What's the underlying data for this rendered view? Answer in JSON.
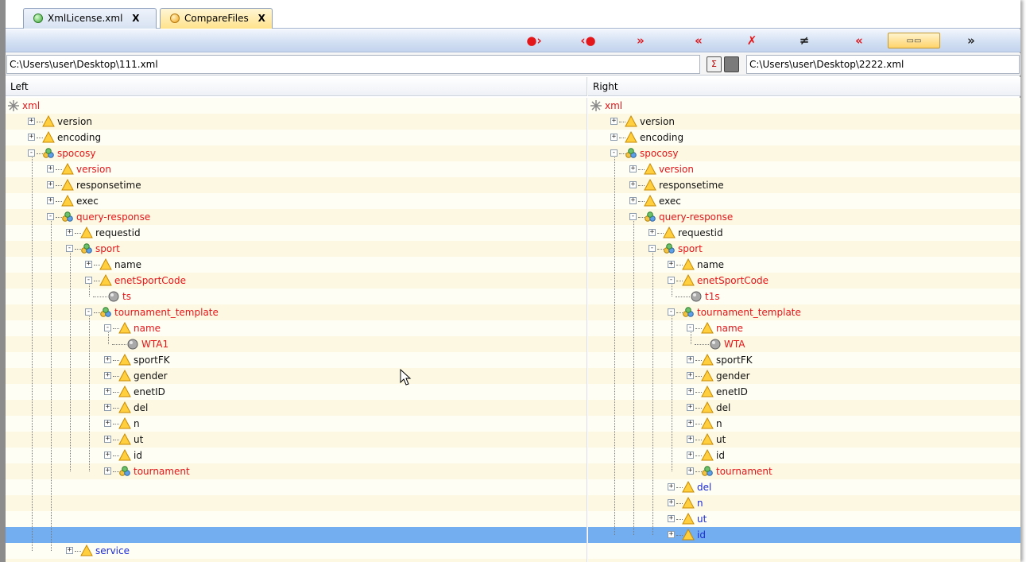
{
  "tabs": [
    {
      "label": "XmlLicense.xml",
      "close": "X",
      "active": false
    },
    {
      "label": "CompareFiles",
      "close": "X",
      "active": true
    }
  ],
  "toolbar": {
    "buttons": [
      {
        "name": "next-diff-icon",
        "glyph": "●›"
      },
      {
        "name": "prev-diff-icon",
        "glyph": "‹●"
      },
      {
        "name": "copy-right-icon",
        "glyph": "»"
      },
      {
        "name": "copy-left-icon",
        "glyph": "«"
      },
      {
        "name": "clear-icon",
        "glyph": "✗"
      },
      {
        "name": "not-equal-icon",
        "glyph": "≠"
      },
      {
        "name": "previous-icon",
        "glyph": "«"
      },
      {
        "name": "view-toggle-icon",
        "glyph": "▭▭"
      },
      {
        "name": "forward-icon",
        "glyph": "»"
      }
    ]
  },
  "paths": {
    "left": "C:\\Users\\user\\Desktop\\111.xml",
    "right": "C:\\Users\\user\\Desktop\\2222.xml"
  },
  "panels": {
    "left_title": "Left",
    "right_title": "Right"
  },
  "colors": {
    "diff": "#e3161a",
    "normal": "#111111",
    "added": "#1c2cd6",
    "selection": "#72aef0"
  },
  "left_tree": [
    {
      "label": "xml",
      "depth": 0,
      "kind": "root",
      "color": "red"
    },
    {
      "label": "version",
      "depth": 1,
      "kind": "attr",
      "color": "black",
      "expander": "+"
    },
    {
      "label": "encoding",
      "depth": 1,
      "kind": "attr",
      "color": "black",
      "expander": "+"
    },
    {
      "label": "spocosy",
      "depth": 1,
      "kind": "elem",
      "color": "red",
      "expander": "-"
    },
    {
      "label": "version",
      "depth": 2,
      "kind": "attr",
      "color": "red",
      "expander": "+"
    },
    {
      "label": "responsetime",
      "depth": 2,
      "kind": "attr",
      "color": "black",
      "expander": "+"
    },
    {
      "label": "exec",
      "depth": 2,
      "kind": "attr",
      "color": "black",
      "expander": "+"
    },
    {
      "label": "query-response",
      "depth": 2,
      "kind": "elem",
      "color": "red",
      "expander": "-"
    },
    {
      "label": "requestid",
      "depth": 3,
      "kind": "attr",
      "color": "black",
      "expander": "+"
    },
    {
      "label": "sport",
      "depth": 3,
      "kind": "elem",
      "color": "red",
      "expander": "-"
    },
    {
      "label": "name",
      "depth": 4,
      "kind": "attr",
      "color": "black",
      "expander": "+"
    },
    {
      "label": "enetSportCode",
      "depth": 4,
      "kind": "attr",
      "color": "red",
      "expander": "-"
    },
    {
      "label": "ts",
      "depth": 5,
      "kind": "value",
      "color": "red"
    },
    {
      "label": "tournament_template",
      "depth": 4,
      "kind": "elem",
      "color": "red",
      "expander": "-"
    },
    {
      "label": "name",
      "depth": 5,
      "kind": "attr",
      "color": "red",
      "expander": "-"
    },
    {
      "label": "WTA1",
      "depth": 6,
      "kind": "value",
      "color": "red"
    },
    {
      "label": "sportFK",
      "depth": 5,
      "kind": "attr",
      "color": "black",
      "expander": "+"
    },
    {
      "label": "gender",
      "depth": 5,
      "kind": "attr",
      "color": "black",
      "expander": "+"
    },
    {
      "label": "enetID",
      "depth": 5,
      "kind": "attr",
      "color": "black",
      "expander": "+"
    },
    {
      "label": "del",
      "depth": 5,
      "kind": "attr",
      "color": "black",
      "expander": "+"
    },
    {
      "label": "n",
      "depth": 5,
      "kind": "attr",
      "color": "black",
      "expander": "+"
    },
    {
      "label": "ut",
      "depth": 5,
      "kind": "attr",
      "color": "black",
      "expander": "+"
    },
    {
      "label": "id",
      "depth": 5,
      "kind": "attr",
      "color": "black",
      "expander": "+"
    },
    {
      "label": "tournament",
      "depth": 5,
      "kind": "elem",
      "color": "red",
      "expander": "+"
    },
    {
      "label": "",
      "depth": 0,
      "kind": "blank"
    },
    {
      "label": "",
      "depth": 0,
      "kind": "blank"
    },
    {
      "label": "",
      "depth": 0,
      "kind": "blank"
    },
    {
      "label": "",
      "depth": 0,
      "kind": "selected"
    },
    {
      "label": "service",
      "depth": 3,
      "kind": "attr",
      "color": "blue",
      "expander": "+"
    }
  ],
  "right_tree": [
    {
      "label": "xml",
      "depth": 0,
      "kind": "root",
      "color": "red"
    },
    {
      "label": "version",
      "depth": 1,
      "kind": "attr",
      "color": "black",
      "expander": "+"
    },
    {
      "label": "encoding",
      "depth": 1,
      "kind": "attr",
      "color": "black",
      "expander": "+"
    },
    {
      "label": "spocosy",
      "depth": 1,
      "kind": "elem",
      "color": "red",
      "expander": "-"
    },
    {
      "label": "version",
      "depth": 2,
      "kind": "attr",
      "color": "red",
      "expander": "+"
    },
    {
      "label": "responsetime",
      "depth": 2,
      "kind": "attr",
      "color": "black",
      "expander": "+"
    },
    {
      "label": "exec",
      "depth": 2,
      "kind": "attr",
      "color": "black",
      "expander": "+"
    },
    {
      "label": "query-response",
      "depth": 2,
      "kind": "elem",
      "color": "red",
      "expander": "-"
    },
    {
      "label": "requestid",
      "depth": 3,
      "kind": "attr",
      "color": "black",
      "expander": "+"
    },
    {
      "label": "sport",
      "depth": 3,
      "kind": "elem",
      "color": "red",
      "expander": "-"
    },
    {
      "label": "name",
      "depth": 4,
      "kind": "attr",
      "color": "black",
      "expander": "+"
    },
    {
      "label": "enetSportCode",
      "depth": 4,
      "kind": "attr",
      "color": "red",
      "expander": "-"
    },
    {
      "label": "t1s",
      "depth": 5,
      "kind": "value",
      "color": "red"
    },
    {
      "label": "tournament_template",
      "depth": 4,
      "kind": "elem",
      "color": "red",
      "expander": "-"
    },
    {
      "label": "name",
      "depth": 5,
      "kind": "attr",
      "color": "red",
      "expander": "-"
    },
    {
      "label": "WTA",
      "depth": 6,
      "kind": "value",
      "color": "red"
    },
    {
      "label": "sportFK",
      "depth": 5,
      "kind": "attr",
      "color": "black",
      "expander": "+"
    },
    {
      "label": "gender",
      "depth": 5,
      "kind": "attr",
      "color": "black",
      "expander": "+"
    },
    {
      "label": "enetID",
      "depth": 5,
      "kind": "attr",
      "color": "black",
      "expander": "+"
    },
    {
      "label": "del",
      "depth": 5,
      "kind": "attr",
      "color": "black",
      "expander": "+"
    },
    {
      "label": "n",
      "depth": 5,
      "kind": "attr",
      "color": "black",
      "expander": "+"
    },
    {
      "label": "ut",
      "depth": 5,
      "kind": "attr",
      "color": "black",
      "expander": "+"
    },
    {
      "label": "id",
      "depth": 5,
      "kind": "attr",
      "color": "black",
      "expander": "+"
    },
    {
      "label": "tournament",
      "depth": 5,
      "kind": "elem",
      "color": "red",
      "expander": "+"
    },
    {
      "label": "del",
      "depth": 4,
      "kind": "attr",
      "color": "blue",
      "expander": "+"
    },
    {
      "label": "n",
      "depth": 4,
      "kind": "attr",
      "color": "blue",
      "expander": "+"
    },
    {
      "label": "ut",
      "depth": 4,
      "kind": "attr",
      "color": "blue",
      "expander": "+"
    },
    {
      "label": "id",
      "depth": 4,
      "kind": "attr",
      "color": "blue",
      "expander": "+",
      "selected": true
    }
  ]
}
